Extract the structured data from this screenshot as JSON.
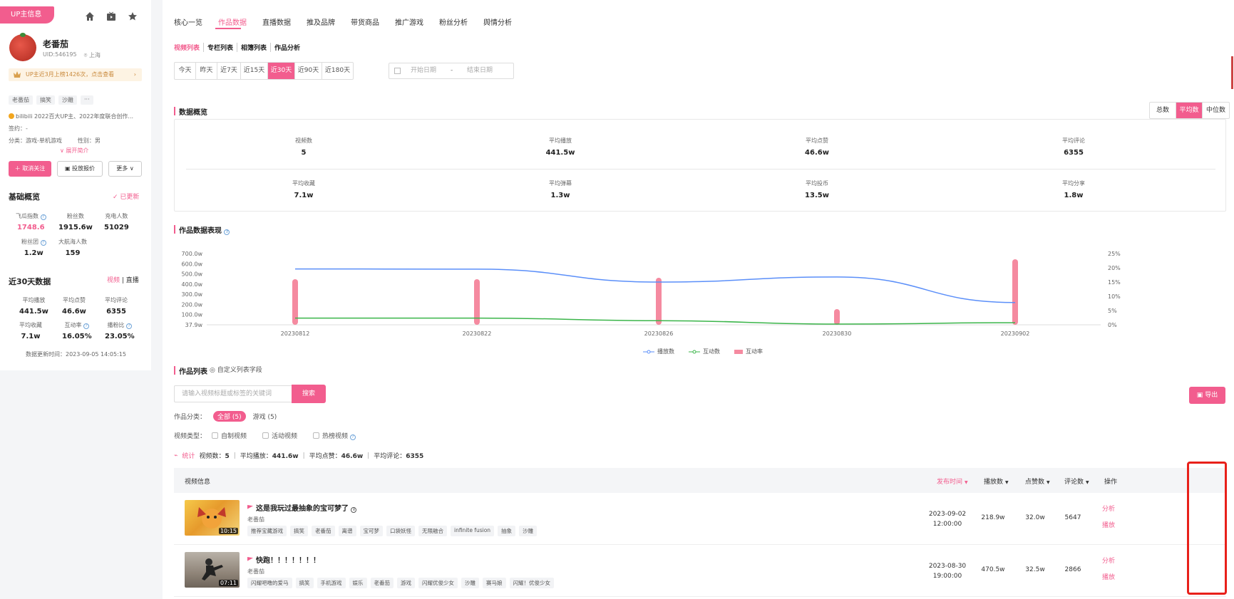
{
  "left": {
    "up_tag": "UP主信息",
    "name": "老番茄",
    "uid": "UID:546195",
    "location": "上海",
    "rank_notice": "UP主近3月上榜1426次，点击查看",
    "tags": [
      "老番茄",
      "搞笑",
      "沙雕",
      "···"
    ],
    "desc_line1": "bilibili 2022百大UP主、2022年度联合创作...",
    "desc_line2": "签约：-",
    "desc_line3a": "分类：游戏-单机游戏",
    "desc_line3b": "性别：男",
    "expand_label": "∨ 展开简介",
    "btn_follow": "取消关注",
    "btn_quote": "投放报价",
    "btn_more": "更多",
    "basic_title": "基础概览",
    "updated_label": "已更新",
    "basic_metrics": [
      {
        "label": "飞瓜指数",
        "value": "1748.6"
      },
      {
        "label": "粉丝数",
        "value": "1915.6w"
      },
      {
        "label": "充电人数",
        "value": "51029"
      },
      {
        "label": "粉丝团",
        "value": "1.2w"
      },
      {
        "label": "大航海人数",
        "value": "159"
      }
    ],
    "recent_title": "近30天数据",
    "recent_tab_video": "视频",
    "recent_tab_live": "直播",
    "recent_metrics": [
      {
        "label": "平均播放",
        "value": "441.5w"
      },
      {
        "label": "平均点赞",
        "value": "46.6w"
      },
      {
        "label": "平均评论",
        "value": "6355"
      },
      {
        "label": "平均收藏",
        "value": "7.1w"
      },
      {
        "label": "互动率",
        "value": "16.05%"
      },
      {
        "label": "播粉比",
        "value": "23.05%"
      }
    ],
    "update_time": "数据更新时间：2023-09-05 14:05:15"
  },
  "nav": [
    "核心一览",
    "作品数据",
    "直播数据",
    "推及品牌",
    "带货商品",
    "推广游戏",
    "粉丝分析",
    "舆情分析"
  ],
  "sub_nav": [
    "视频列表",
    "专栏列表",
    "相簿列表",
    "作品分析"
  ],
  "ranges": [
    "今天",
    "昨天",
    "近7天",
    "近15天",
    "近30天",
    "近90天",
    "近180天"
  ],
  "date_start": "开始日期",
  "date_sep": "-",
  "date_end": "结束日期",
  "overview_title": "数据概览",
  "overview_toggle": [
    "总数",
    "平均数",
    "中位数"
  ],
  "overview": [
    {
      "label": "视频数",
      "value": "5"
    },
    {
      "label": "平均播放",
      "value": "441.5w"
    },
    {
      "label": "平均点赞",
      "value": "46.6w"
    },
    {
      "label": "平均评论",
      "value": "6355"
    },
    {
      "label": "平均收藏",
      "value": "7.1w"
    },
    {
      "label": "平均弹幕",
      "value": "1.3w"
    },
    {
      "label": "平均投币",
      "value": "13.5w"
    },
    {
      "label": "平均分享",
      "value": "1.8w"
    }
  ],
  "performance_title": "作品数据表现",
  "chart_data": {
    "type": "line",
    "x": [
      "20230812",
      "20230822",
      "20230826",
      "20230830",
      "20230902"
    ],
    "y_left_ticks": [
      "700.0w",
      "600.0w",
      "500.0w",
      "400.0w",
      "300.0w",
      "200.0w",
      "100.0w",
      "37.9w"
    ],
    "y_right_ticks": [
      "25%",
      "20%",
      "15%",
      "10%",
      "5%",
      "0%"
    ],
    "ylim_left": [
      0,
      700
    ],
    "ylim_right": [
      0,
      25
    ],
    "series": [
      {
        "name": "播放数",
        "axis": "left",
        "color": "#5b8ff9",
        "values": [
          549,
          547,
          420,
          470,
          219
        ]
      },
      {
        "name": "互动数",
        "axis": "left",
        "color": "#3bb54a",
        "values": [
          66,
          66,
          40,
          7,
          20
        ]
      },
      {
        "name": "互动率",
        "axis": "right",
        "color": "#f58aa0",
        "type": "bar",
        "values": [
          16,
          16,
          16.5,
          5.5,
          23
        ]
      }
    ]
  },
  "list_title": "作品列表",
  "list_custom": "◎ 自定义列表字段",
  "search_placeholder": "请输入视频标题或标签的关键词",
  "search_btn": "搜索",
  "export_btn": "导出",
  "category_label": "作品分类：",
  "category_all": "全部 (5)",
  "category_game": "游戏 (5)",
  "type_label": "视频类型：",
  "type_options": [
    "自制视频",
    "活动视频",
    "热榜视频"
  ],
  "stat_label": "统计",
  "stat_items": [
    {
      "k": "视频数：",
      "v": "5"
    },
    {
      "k": "平均播放：",
      "v": "441.6w"
    },
    {
      "k": "平均点赞：",
      "v": "46.6w"
    },
    {
      "k": "平均评论：",
      "v": "6355"
    }
  ],
  "table_headers": {
    "video_info": "视频信息",
    "publish_time": "发布时间",
    "plays": "播放数",
    "likes": "点赞数",
    "comments": "评论数",
    "ops": "操作"
  },
  "rows": [
    {
      "title": "这是我玩过最抽象的宝可梦了",
      "author": "老番茄",
      "duration": "10:15",
      "tags": [
        "推荐宝藏游戏",
        "搞笑",
        "老番茄",
        "离谱",
        "宝可梦",
        "口袋妖怪",
        "无限融合",
        "infinite fusion",
        "抽象",
        "沙雕"
      ],
      "date": "2023-09-02",
      "time": "12:00:00",
      "plays": "218.9w",
      "likes": "32.0w",
      "comments": "5647",
      "op1": "分析",
      "op2": "播放"
    },
    {
      "title": "快跑！！！！！！！",
      "author": "老番茄",
      "duration": "07:11",
      "tags": [
        "闪耀吧噜的爱马",
        "搞笑",
        "手机游戏",
        "娱乐",
        "老番茄",
        "游戏",
        "闪耀优俊少女",
        "沙雕",
        "赛马娘",
        "闪耀！优俊少女"
      ],
      "date": "2023-08-30",
      "time": "19:00:00",
      "plays": "470.5w",
      "likes": "32.5w",
      "comments": "2866",
      "op1": "分析",
      "op2": "播放"
    }
  ]
}
